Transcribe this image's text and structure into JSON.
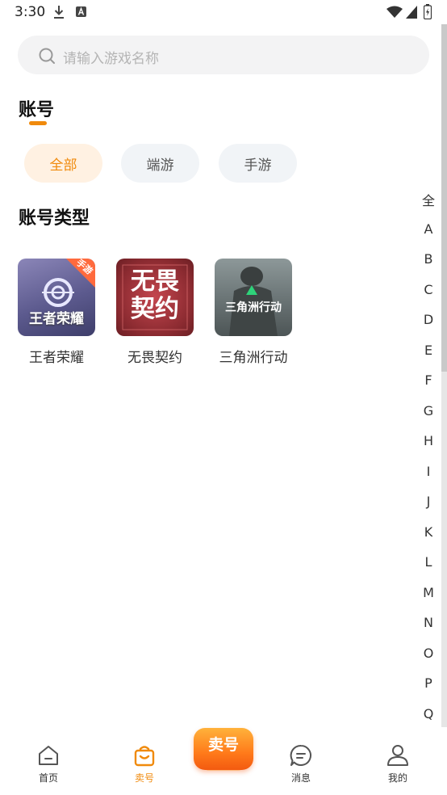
{
  "status_bar": {
    "time": "3:30",
    "icons": [
      "download-icon",
      "a-badge-icon",
      "wifi-icon",
      "signal-icon",
      "battery-icon"
    ]
  },
  "search": {
    "placeholder": "请输入游戏名称"
  },
  "account_section": {
    "title": "账号",
    "accent_color": "#f08a0c",
    "filters": [
      {
        "label": "全部",
        "selected": true
      },
      {
        "label": "端游",
        "selected": false
      },
      {
        "label": "手游",
        "selected": false
      }
    ]
  },
  "type_section": {
    "title": "账号类型",
    "games": [
      {
        "name": "王者荣耀",
        "badge": "手游",
        "logo_text": "王者荣耀"
      },
      {
        "name": "无畏契约",
        "logo_text": "无畏契约"
      },
      {
        "name": "三角洲行动",
        "logo_text": "三角洲行动"
      }
    ]
  },
  "alphabet_index": [
    "全",
    "A",
    "B",
    "C",
    "D",
    "E",
    "F",
    "G",
    "H",
    "I",
    "J",
    "K",
    "L",
    "M",
    "N",
    "O",
    "P",
    "Q"
  ],
  "tabbar": {
    "home": "首页",
    "sell": "卖号",
    "sell_button": "卖号",
    "messages": "消息",
    "mine": "我的",
    "active_tab": "sell"
  }
}
